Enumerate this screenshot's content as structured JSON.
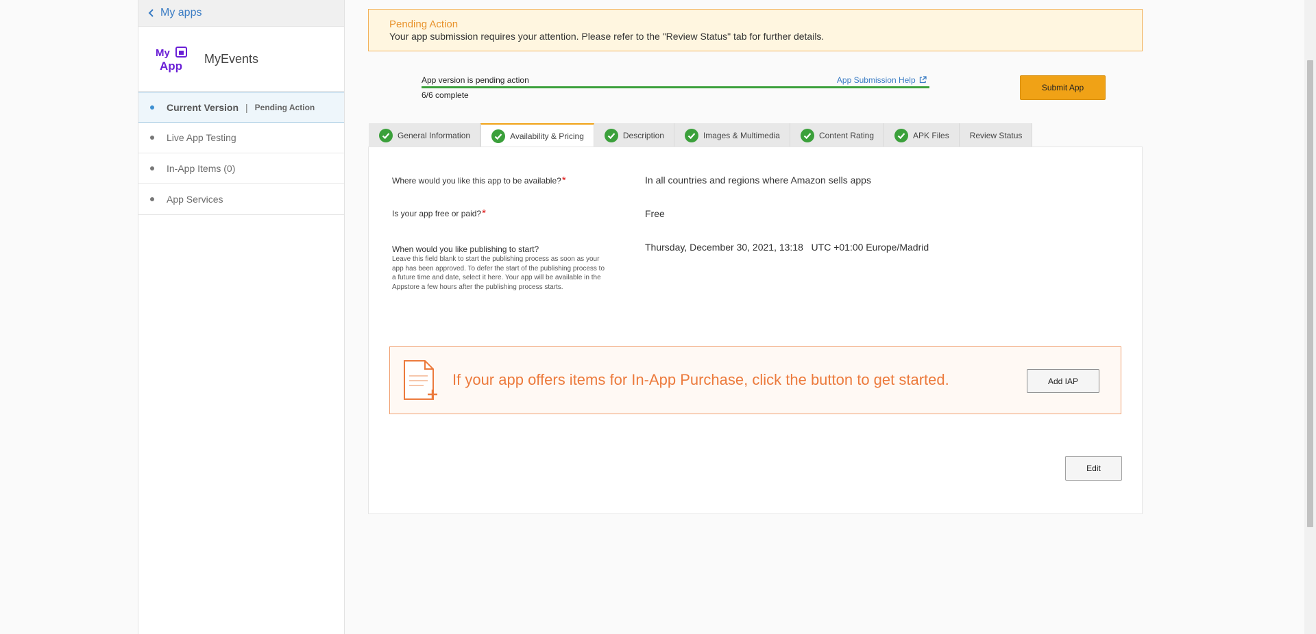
{
  "sidebar": {
    "back_label": "My apps",
    "app_name": "MyEvents",
    "logo_text_top": "My",
    "logo_text_bottom": "App",
    "items": [
      {
        "label": "Current Version",
        "separator": "|",
        "status": "Pending Action"
      },
      {
        "label": "Live App Testing"
      },
      {
        "label": "In-App Items (0)"
      },
      {
        "label": "App Services"
      }
    ]
  },
  "alert": {
    "title": "Pending Action",
    "message": "Your app submission requires your attention. Please refer to the \"Review Status\" tab for further details."
  },
  "progress": {
    "label": "App version is pending action",
    "help_link": "App Submission Help",
    "count": "6/6 complete",
    "fraction": 1.0,
    "color": "#3ba03b"
  },
  "submit_button": "Submit App",
  "tabs": [
    {
      "label": "General Information",
      "complete": true
    },
    {
      "label": "Availability & Pricing",
      "complete": true,
      "active": true
    },
    {
      "label": "Description",
      "complete": true
    },
    {
      "label": "Images & Multimedia",
      "complete": true
    },
    {
      "label": "Content Rating",
      "complete": true
    },
    {
      "label": "APK Files",
      "complete": true
    },
    {
      "label": "Review Status",
      "complete": false
    }
  ],
  "form": {
    "availability_q": "Where would you like this app to be available?",
    "availability_a": "In all countries and regions where Amazon sells apps",
    "price_q": "Is your app free or paid?",
    "price_a": "Free",
    "publish_q": "When would you like publishing to start?",
    "publish_help": "Leave this field blank to start the publishing process as soon as your app has been approved. To defer the start of the publishing process to a future time and date, select it here. Your app will be available in the Appstore a few hours after the publishing process starts.",
    "publish_a": "Thursday, December 30, 2021, 13:18   UTC +01:00 Europe/Madrid",
    "required_mark": "*"
  },
  "iap": {
    "message": "If your app offers items for In-App Purchase, click the button to get started.",
    "button": "Add IAP"
  },
  "edit_button": "Edit",
  "colors": {
    "accent": "#f0a216",
    "link": "#3a7cc4",
    "success": "#3ba03b",
    "iap": "#ec7a3c"
  }
}
